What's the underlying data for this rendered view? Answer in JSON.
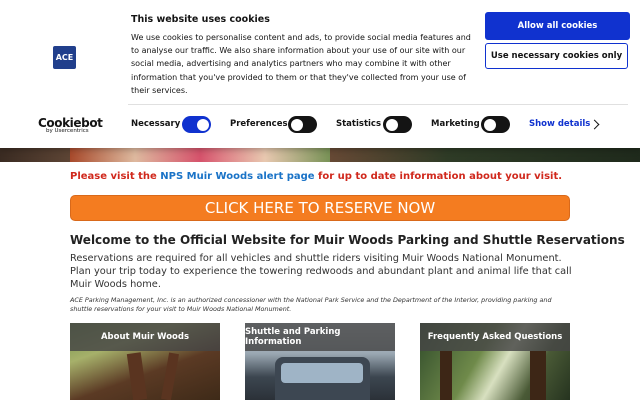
{
  "cookie_banner": {
    "logo_text": "ACE",
    "title": "This website uses cookies",
    "body": "We use cookies to personalise content and ads, to provide social media features and to analyse our traffic. We also share information about your use of our site with our social media, advertising and analytics partners who may combine it with other information that you've provided to them or that they've collected from your use of their services.",
    "allow_all_label": "Allow all cookies",
    "necessary_only_label": "Use necessary cookies only",
    "brand": "Cookiebot",
    "brand_sub": "by Usercentrics",
    "toggles": [
      {
        "label": "Necessary",
        "on": true
      },
      {
        "label": "Preferences",
        "on": false
      },
      {
        "label": "Statistics",
        "on": false
      },
      {
        "label": "Marketing",
        "on": false
      }
    ],
    "show_details_label": "Show details",
    "accent_color": "#1032cf"
  },
  "alert": {
    "prefix": "Please visit the ",
    "link_text": "NPS Muir Woods alert page",
    "suffix": " for up to date information about your visit."
  },
  "reserve_button": {
    "label": "CLICK HERE TO RESERVE NOW",
    "color": "#f47c20"
  },
  "welcome": {
    "heading": "Welcome to the Official Website for Muir Woods Parking and Shuttle Reservations",
    "intro": "Reservations are required for all vehicles and shuttle riders visiting Muir Woods National Monument. Plan your trip today to experience the towering redwoods and abundant plant and animal life that call Muir Woods home.",
    "concession": "ACE Parking Management, Inc. is an authorized concessioner with the National Park Service and the Department of the Interior, providing parking and shuttle reservations for your visit to Muir Woods National Monument."
  },
  "cards": [
    {
      "label": "About Muir Woods"
    },
    {
      "label": "Shuttle and Parking Information"
    },
    {
      "label": "Frequently Asked Questions"
    }
  ]
}
